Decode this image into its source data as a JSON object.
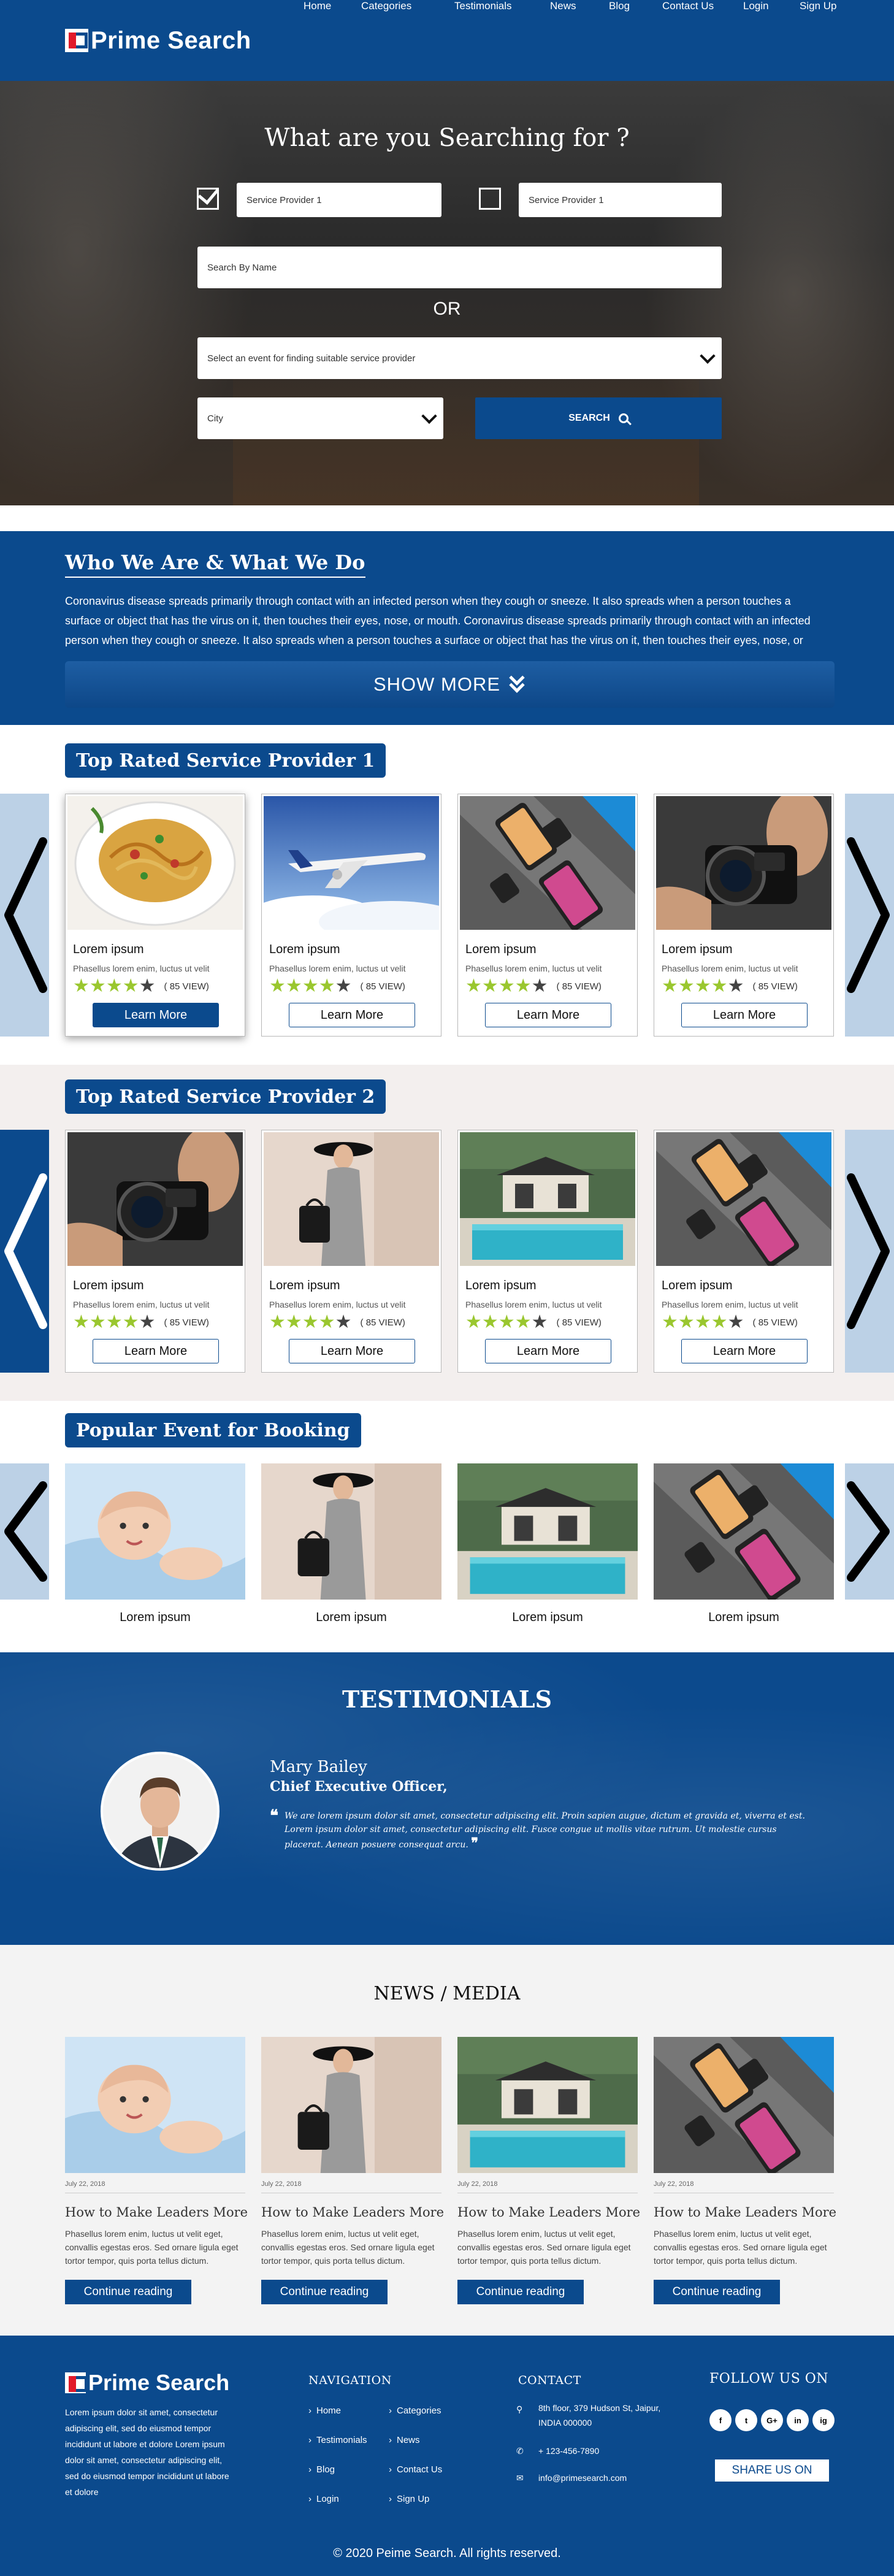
{
  "brand": {
    "name": "Prime Search"
  },
  "nav": {
    "items": [
      "Home",
      "Categories",
      "Testimonials",
      "News",
      "Blog",
      "Contact Us",
      "Login",
      "Sign Up"
    ]
  },
  "hero": {
    "title": "What are you Searching for ?",
    "provider1": {
      "value": "Service Provider 1",
      "checked": true
    },
    "provider2": {
      "value": "Service Provider 1",
      "checked": false
    },
    "search_name_placeholder": "Search By Name",
    "or_label": "OR",
    "event_select": "Select an event for finding suitable service provider",
    "city_select": "City",
    "search_button": "SEARCH"
  },
  "about": {
    "title": "Who We Are & What We Do",
    "text": "Coronavirus disease spreads primarily through contact with an infected person when they cough or sneeze. It also spreads when a person touches a surface or object that has the virus on it, then touches their eyes, nose, or mouth. Coronavirus disease spreads primarily through contact with an infected person when they cough or sneeze. It also spreads when a person touches a surface or object that has the virus on it, then touches their eyes, nose, or",
    "show_more": "SHOW MORE"
  },
  "section1": {
    "title": "Top Rated Service Provider 1",
    "cards": [
      {
        "image": "pasta-plate",
        "title": "Lorem ipsum",
        "sub": "Phasellus lorem enim, luctus ut velit",
        "rating": 4,
        "views": "( 85 VIEW)",
        "button": "Learn More"
      },
      {
        "image": "airplane",
        "title": "Lorem ipsum",
        "sub": "Phasellus lorem enim, luctus ut velit",
        "rating": 4,
        "views": "( 85 VIEW)",
        "button": "Learn More"
      },
      {
        "image": "phones-watches",
        "title": "Lorem ipsum",
        "sub": "Phasellus lorem enim, luctus ut velit",
        "rating": 4,
        "views": "( 85 VIEW)",
        "button": "Learn More"
      },
      {
        "image": "camera",
        "title": "Lorem ipsum",
        "sub": "Phasellus lorem enim, luctus ut velit",
        "rating": 4,
        "views": "( 85 VIEW)",
        "button": "Learn More"
      }
    ]
  },
  "section2": {
    "title": "Top Rated Service Provider 2",
    "cards": [
      {
        "image": "camera",
        "title": "Lorem ipsum",
        "sub": "Phasellus lorem enim, luctus ut velit",
        "rating": 4,
        "views": "( 85 VIEW)",
        "button": "Learn More"
      },
      {
        "image": "fashion-woman",
        "title": "Lorem ipsum",
        "sub": "Phasellus lorem enim, luctus ut velit",
        "rating": 4,
        "views": "( 85 VIEW)",
        "button": "Learn More"
      },
      {
        "image": "pool-house",
        "title": "Lorem ipsum",
        "sub": "Phasellus lorem enim, luctus ut velit",
        "rating": 4,
        "views": "( 85 VIEW)",
        "button": "Learn More"
      },
      {
        "image": "phones-watches",
        "title": "Lorem ipsum",
        "sub": "Phasellus lorem enim, luctus ut velit",
        "rating": 4,
        "views": "( 85 VIEW)",
        "button": "Learn More"
      }
    ]
  },
  "events": {
    "title": "Popular Event for Booking",
    "items": [
      {
        "image": "baby",
        "label": "Lorem ipsum"
      },
      {
        "image": "fashion-woman",
        "label": "Lorem ipsum"
      },
      {
        "image": "pool-house",
        "label": "Lorem ipsum"
      },
      {
        "image": "phones-watches",
        "label": "Lorem ipsum"
      }
    ]
  },
  "testimonials": {
    "title": "TESTIMONIALS",
    "name": "Mary Bailey",
    "role": "Chief Executive Officer,",
    "quote": "We are lorem ipsum dolor sit amet, consectetur adipiscing elit. Proin sapien augue, dictum et gravida et, viverra et est. Lorem ipsum dolor sit amet, consectetur adipiscing elit. Fusce congue ut mollis vitae rutrum. Ut molestie cursus placerat. Aenean posuere consequat arcu."
  },
  "news": {
    "title": "NEWS / MEDIA",
    "items": [
      {
        "image": "baby",
        "date": "July 22, 2018",
        "headline": "How to Make Leaders More",
        "text": "Phasellus lorem enim, luctus ut velit eget, convallis egestas eros. Sed ornare ligula eget tortor tempor, quis porta tellus dictum.",
        "button": "Continue reading"
      },
      {
        "image": "fashion-woman",
        "date": "July 22, 2018",
        "headline": "How to Make Leaders More",
        "text": "Phasellus lorem enim, luctus ut velit eget, convallis egestas eros. Sed ornare ligula eget tortor tempor, quis porta tellus dictum.",
        "button": "Continue reading"
      },
      {
        "image": "pool-house",
        "date": "July 22, 2018",
        "headline": "How to Make Leaders More",
        "text": "Phasellus lorem enim, luctus ut velit eget, convallis egestas eros. Sed ornare ligula eget tortor tempor, quis porta tellus dictum.",
        "button": "Continue reading"
      },
      {
        "image": "phones-watches",
        "date": "July 22, 2018",
        "headline": "How to Make Leaders More",
        "text": "Phasellus lorem enim, luctus ut velit eget, convallis egestas eros. Sed ornare ligula eget tortor tempor, quis porta tellus dictum.",
        "button": "Continue reading"
      }
    ]
  },
  "footer": {
    "brand": "Prime Search",
    "about": "Lorem ipsum dolor sit amet, consectetur adipiscing elit, sed do eiusmod tempor incididunt ut labore et dolore Lorem ipsum dolor sit amet, consectetur adipiscing elit, sed do eiusmod tempor incididunt ut labore et dolore",
    "nav_title": "NAVIGATION",
    "nav_links": [
      "Home",
      "Categories",
      "Testimonials",
      "News",
      "Blog",
      "Contact Us",
      "Login",
      "Sign Up"
    ],
    "contact_title": "CONTACT",
    "address": "8th floor, 379 Hudson St, Jaipur, INDIA 000000",
    "phone": "+ 123-456-7890",
    "email": "info@primesearch.com",
    "follow_title": "FOLLOW US ON",
    "social": [
      "f",
      "t",
      "G+",
      "in",
      "ig"
    ],
    "share_button": "SHARE US ON",
    "copyright": "© 2020  Peime Search. All rights reserved."
  },
  "colors": {
    "primary": "#0b4a8d",
    "star": "#9ac72f",
    "arrow_light": "#bcd1e6"
  }
}
